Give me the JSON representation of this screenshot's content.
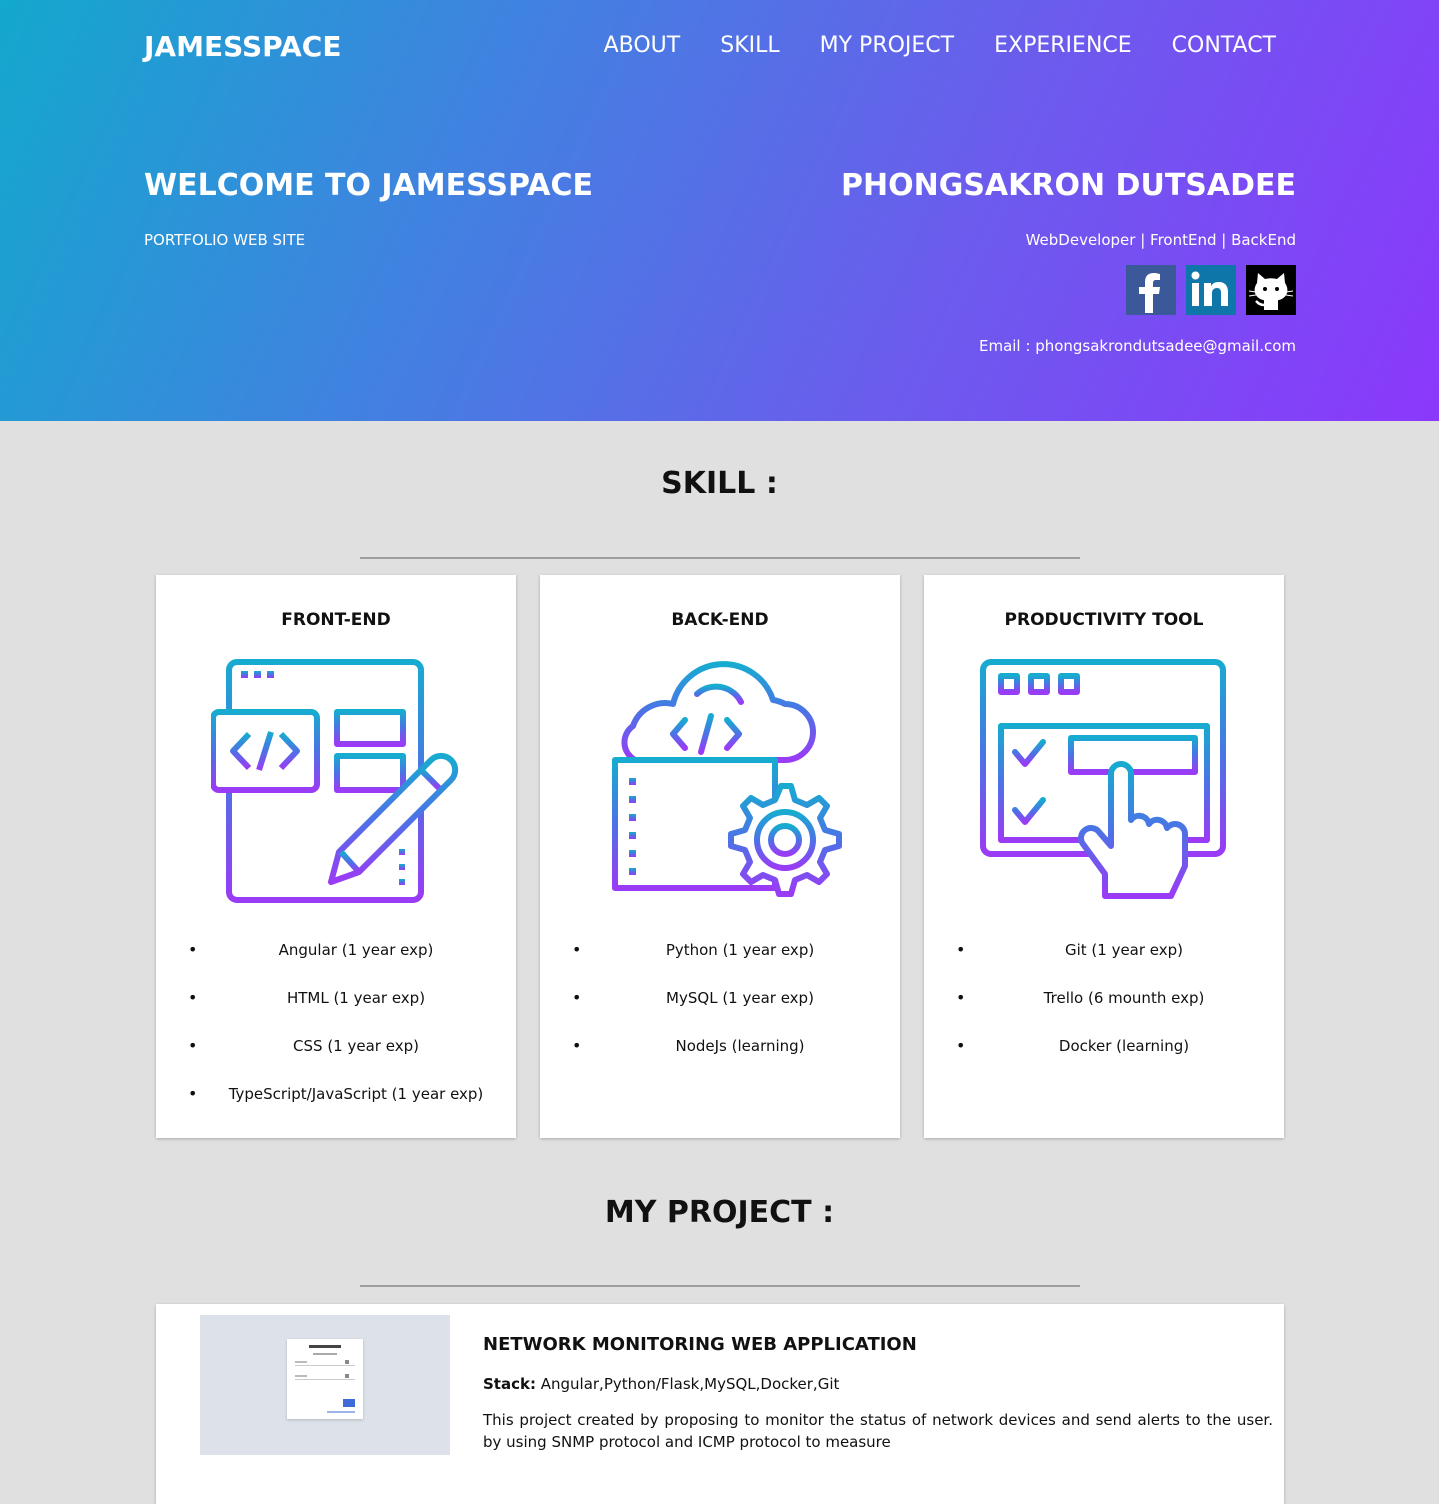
{
  "header": {
    "brand": "JAMESSPACE",
    "nav": [
      "ABOUT",
      "SKILL",
      "MY PROJECT",
      "EXPERIENCE",
      "CONTACT"
    ]
  },
  "hero": {
    "welcome": "WELCOME TO JAMESSPACE",
    "subtitle": "PORTFOLIO WEB SITE",
    "name": "PHONGSAKRON DUTSADEE",
    "roles": "WebDeveloper | FrontEnd | BackEnd",
    "socials": [
      "facebook-icon",
      "linkedin-icon",
      "github-icon"
    ],
    "email": "Email : phongsakrondutsadee@gmail.com"
  },
  "skill": {
    "title": "SKILL :",
    "cards": [
      {
        "title": "FRONT-END",
        "icon": "web-design-icon",
        "items": [
          "Angular (1 year exp)",
          "HTML (1 year exp)",
          "CSS (1 year exp)",
          "TypeScript/JavaScript (1 year exp)"
        ]
      },
      {
        "title": "BACK-END",
        "icon": "cloud-server-icon",
        "items": [
          "Python (1 year exp)",
          "MySQL (1 year exp)",
          "NodeJs (learning)"
        ]
      },
      {
        "title": "PRODUCTIVITY TOOL",
        "icon": "task-board-icon",
        "items": [
          "Git (1 year exp)",
          "Trello (6 mounth exp)",
          "Docker (learning)"
        ]
      }
    ]
  },
  "project": {
    "title": "MY PROJECT :",
    "items": [
      {
        "name": "NETWORK MONITORING WEB APPLICATION",
        "stack_label": "Stack:",
        "stack": " Angular,Python/Flask,MySQL,Docker,Git",
        "description": "This project created by proposing to monitor the status of network devices and send alerts to the user. by using SNMP protocol and ICMP protocol to measure"
      }
    ]
  },
  "colors": {
    "gradient_start": "#13a8cd",
    "gradient_end": "#8b38fb",
    "background": "#e0e0e0"
  }
}
